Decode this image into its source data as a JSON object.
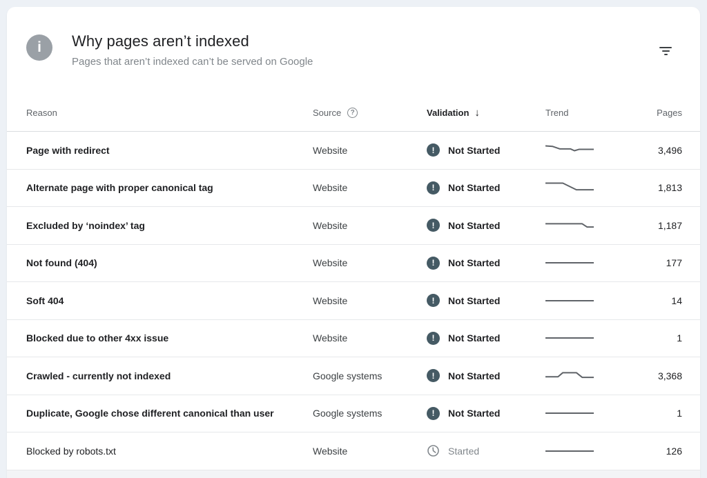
{
  "header": {
    "title": "Why pages aren’t indexed",
    "subtitle": "Pages that aren’t indexed can’t be served on Google",
    "info_icon_glyph": "i",
    "help_icon_glyph": "?"
  },
  "columns": {
    "reason": "Reason",
    "source": "Source",
    "validation": "Validation",
    "trend": "Trend",
    "pages": "Pages",
    "sort_arrow": "↓"
  },
  "rows": [
    {
      "reason": "Page with redirect",
      "source": "Website",
      "validation": "Not Started",
      "state": "not-started",
      "pages": "3,496",
      "trend": [
        [
          0,
          25
        ],
        [
          15,
          28
        ],
        [
          30,
          42
        ],
        [
          52,
          42
        ],
        [
          60,
          52
        ],
        [
          70,
          44
        ],
        [
          100,
          44
        ]
      ]
    },
    {
      "reason": "Alternate page with proper canonical tag",
      "source": "Website",
      "validation": "Not Started",
      "state": "not-started",
      "pages": "1,813",
      "trend": [
        [
          0,
          25
        ],
        [
          36,
          25
        ],
        [
          64,
          62
        ],
        [
          100,
          62
        ]
      ]
    },
    {
      "reason": "Excluded by ‘noindex’ tag",
      "source": "Website",
      "validation": "Not Started",
      "state": "not-started",
      "pages": "1,187",
      "trend": [
        [
          0,
          40
        ],
        [
          76,
          40
        ],
        [
          86,
          58
        ],
        [
          100,
          58
        ]
      ]
    },
    {
      "reason": "Not found (404)",
      "source": "Website",
      "validation": "Not Started",
      "state": "not-started",
      "pages": "177",
      "trend": [
        [
          0,
          50
        ],
        [
          100,
          50
        ]
      ]
    },
    {
      "reason": "Soft 404",
      "source": "Website",
      "validation": "Not Started",
      "state": "not-started",
      "pages": "14",
      "trend": [
        [
          0,
          50
        ],
        [
          100,
          50
        ]
      ]
    },
    {
      "reason": "Blocked due to other 4xx issue",
      "source": "Website",
      "validation": "Not Started",
      "state": "not-started",
      "pages": "1",
      "trend": [
        [
          0,
          50
        ],
        [
          100,
          50
        ]
      ]
    },
    {
      "reason": "Crawled - currently not indexed",
      "source": "Google systems",
      "validation": "Not Started",
      "state": "not-started",
      "pages": "3,368",
      "trend": [
        [
          0,
          55
        ],
        [
          26,
          55
        ],
        [
          36,
          32
        ],
        [
          64,
          32
        ],
        [
          76,
          58
        ],
        [
          100,
          58
        ]
      ]
    },
    {
      "reason": "Duplicate, Google chose different canonical than user",
      "source": "Google systems",
      "validation": "Not Started",
      "state": "not-started",
      "pages": "1",
      "trend": [
        [
          0,
          50
        ],
        [
          100,
          50
        ]
      ]
    },
    {
      "reason": "Blocked by robots.txt",
      "source": "Website",
      "validation": "Started",
      "state": "started",
      "pages": "126",
      "trend": [
        [
          0,
          50
        ],
        [
          100,
          50
        ]
      ]
    }
  ],
  "colors": {
    "page_background": "#edf1f6",
    "not_started_badge": "#455a64",
    "started_icon": "#80868b",
    "sparkline": "#5f6368",
    "title_text": "#202124",
    "muted_text": "#80868b"
  }
}
